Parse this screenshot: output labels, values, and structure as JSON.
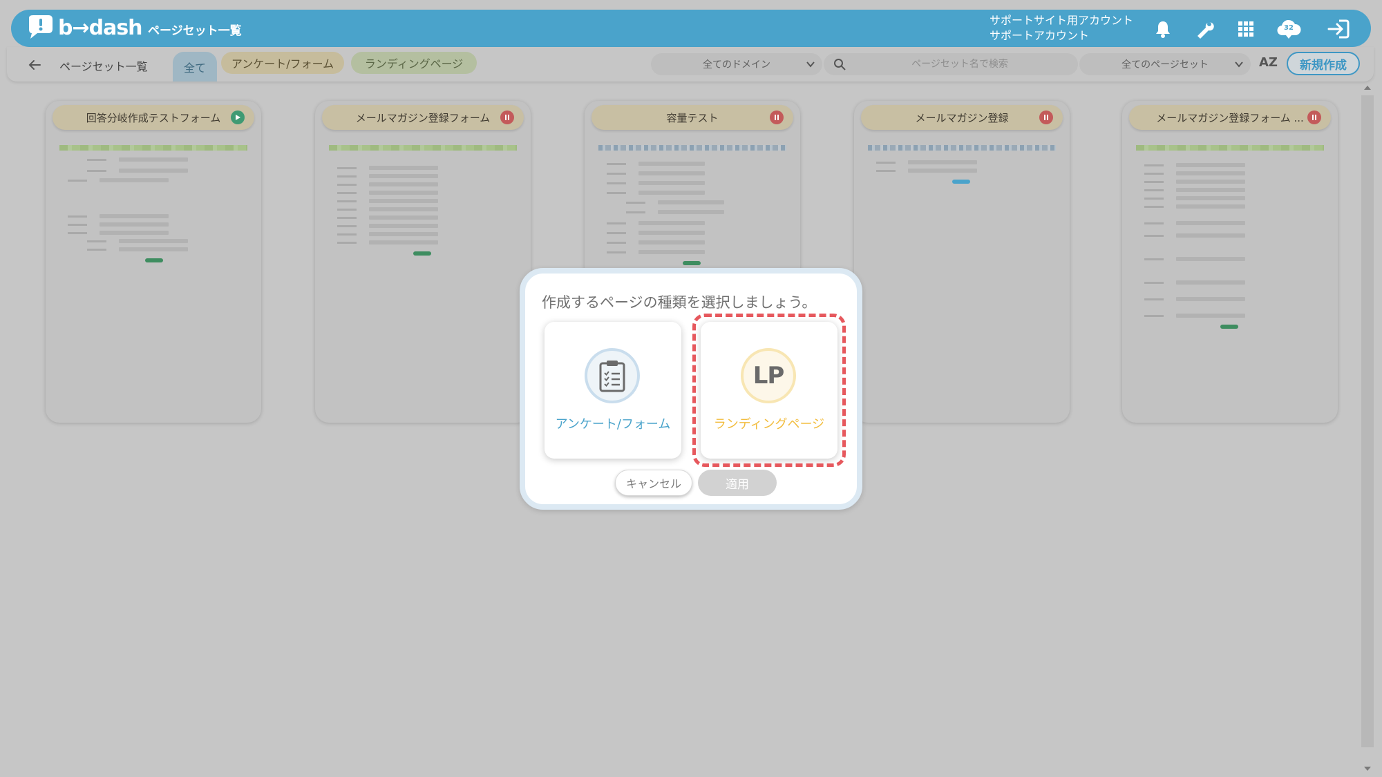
{
  "header": {
    "logo_text": "b→dash",
    "app_title": "ページセット一覧",
    "account_line1": "サポートサイト用アカウント",
    "account_line2": "サポートアカウント",
    "notification_count": "32",
    "brand_color": "#4aa3cb"
  },
  "toolbar": {
    "breadcrumb": "ページセット一覧",
    "tabs": [
      {
        "label": "全て"
      },
      {
        "label": "アンケート/フォーム"
      },
      {
        "label": "ランディングページ"
      }
    ],
    "domain_select": "全てのドメイン",
    "search_placeholder": "ページセット名で検索",
    "pageset_select": "全てのページセット",
    "sort_label": "AZ",
    "new_button": "新規作成"
  },
  "cards": [
    {
      "title": "回答分岐作成テストフォーム",
      "status": "play",
      "status_icon": "play-icon",
      "band": "green"
    },
    {
      "title": "メールマガジン登録フォーム",
      "status": "pause",
      "status_icon": "pause-icon",
      "band": "green"
    },
    {
      "title": "容量テスト",
      "status": "pause",
      "status_icon": "pause-icon",
      "band": "blue"
    },
    {
      "title": "メールマガジン登録",
      "status": "pause",
      "status_icon": "pause-icon",
      "band": "blue"
    },
    {
      "title": "メールマガジン登録フォーム ...",
      "status": "pause",
      "status_icon": "pause-icon",
      "band": "green"
    }
  ],
  "modal": {
    "title": "作成するページの種類を選択しましょう。",
    "option_form_label": "アンケート/フォーム",
    "option_form_icon": "clipboard-checklist-icon",
    "option_lp_label": "ランディングページ",
    "option_lp_icon_text": "LP",
    "cancel_label": "キャンセル",
    "apply_label": "適用",
    "form_color": "#4aa3cb",
    "lp_color": "#f2bd3f",
    "highlight_color": "#e6585d"
  }
}
